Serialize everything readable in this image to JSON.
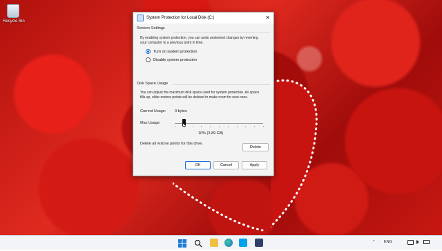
{
  "desktop": {
    "recycle_bin_label": "Recycle Bin"
  },
  "dialog": {
    "title": "System Protection for Local Disk (C:)",
    "restore_settings": {
      "heading": "Restore Settings",
      "description": "By enabling system protection, you can undo undesired changes by reverting your computer to a previous point in time.",
      "options": [
        {
          "label": "Turn on system protection",
          "selected": true
        },
        {
          "label": "Disable system protection",
          "selected": false
        }
      ]
    },
    "disk_space": {
      "heading": "Disk Space Usage",
      "description": "You can adjust the maximum disk space used for system protection. As space fills up, older restore points will be deleted to make room for new ones.",
      "current_usage_label": "Current Usage:",
      "current_usage_value": "0 bytes",
      "max_usage_label": "Max Usage:",
      "max_usage_fraction": 0.1,
      "max_usage_readout": "10% (3.89 GB)"
    },
    "delete_text": "Delete all restore points for this drive.",
    "buttons": {
      "delete": "Delete",
      "ok": "OK",
      "cancel": "Cancel",
      "apply": "Apply"
    }
  },
  "taskbar": {
    "icons": [
      "windows-start-icon",
      "search-icon",
      "file-explorer-icon",
      "edge-icon",
      "store-icon",
      "skype-icon",
      "app-icon"
    ],
    "tray": {
      "chevron": "^",
      "language": "ENG"
    }
  },
  "colors": {
    "accent": "#1a6ed8",
    "wallpaper": "#c81812"
  }
}
